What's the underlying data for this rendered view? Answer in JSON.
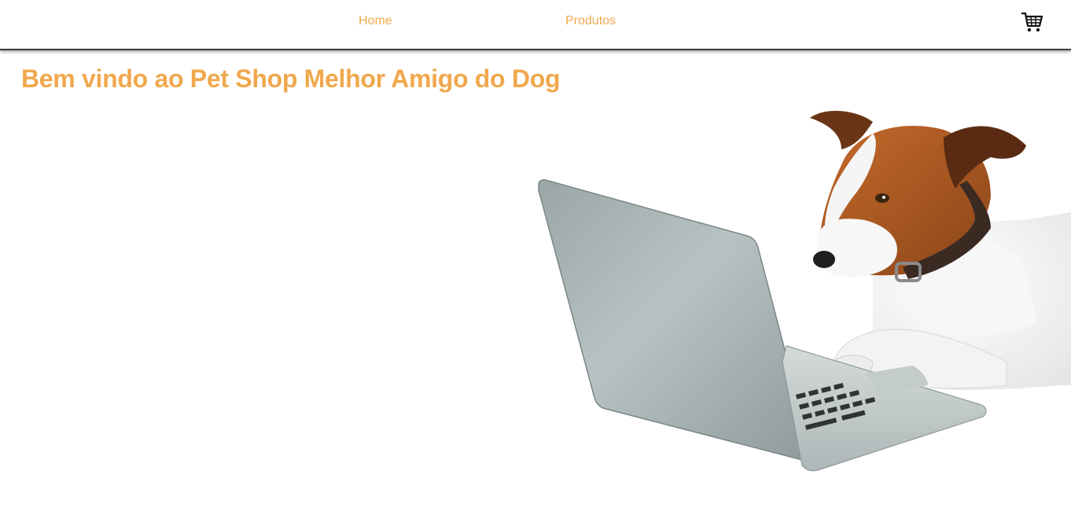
{
  "nav": {
    "items": [
      {
        "label": "Home"
      },
      {
        "label": "Produtos"
      }
    ],
    "cart_icon": "shopping-cart-icon"
  },
  "main": {
    "title": "Bem vindo ao Pet Shop Melhor Amigo do Dog",
    "hero_image": "dog-with-laptop"
  },
  "colors": {
    "accent": "#f0a84e",
    "navbar_border": "#3a3a3a",
    "background": "#ffffff"
  }
}
